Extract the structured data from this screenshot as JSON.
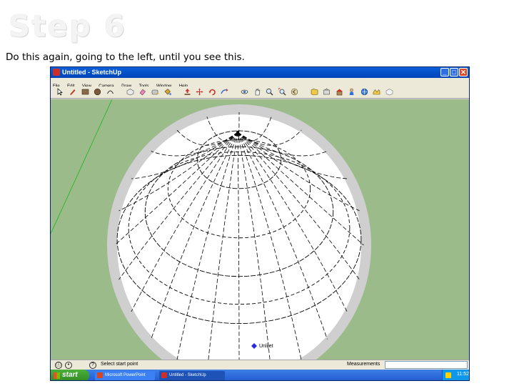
{
  "slide": {
    "title": "Step 6",
    "caption": "Do this again, going to the left, until you see this."
  },
  "window": {
    "title": "Untitled - SketchUp",
    "buttons": {
      "minimize": "_",
      "maximize": "□",
      "close": "✕"
    }
  },
  "menu": [
    "File",
    "Edit",
    "View",
    "Camera",
    "Draw",
    "Tools",
    "Window",
    "Help"
  ],
  "toolbar": {
    "tools": [
      "select-icon",
      "pencil-icon",
      "rectangle-icon",
      "circle-icon",
      "arc-icon",
      "make-component-icon",
      "eraser-icon",
      "tape-measure-icon",
      "paint-bucket-icon",
      "push-pull-icon",
      "move-icon",
      "rotate-icon",
      "follow-me-icon",
      "orbit-icon",
      "pan-icon",
      "zoom-icon",
      "zoom-extents-icon",
      "previous-view-icon",
      "next-view-icon",
      "get-models-icon",
      "share-model-icon",
      "warehouse-icon",
      "position-camera-icon",
      "walk-icon",
      "look-around-icon",
      "section-icon"
    ]
  },
  "viewport": {
    "cursor_label": "Unlijet",
    "colors": {
      "background": "#9bbb8b",
      "sphere": "#ffffff",
      "edge": "#000000",
      "axis": "#1eb41e"
    }
  },
  "status": {
    "hint": "Select start point",
    "measurements_label": "Measurements",
    "measurements_value": "",
    "icons": [
      "info-icon",
      "help-icon"
    ]
  },
  "taskbar": {
    "start_label": "start",
    "tasks": [
      {
        "label": "Microsoft PowerPoint"
      },
      {
        "label": "Untitled - SketchUp"
      }
    ],
    "clock": "11:52"
  }
}
